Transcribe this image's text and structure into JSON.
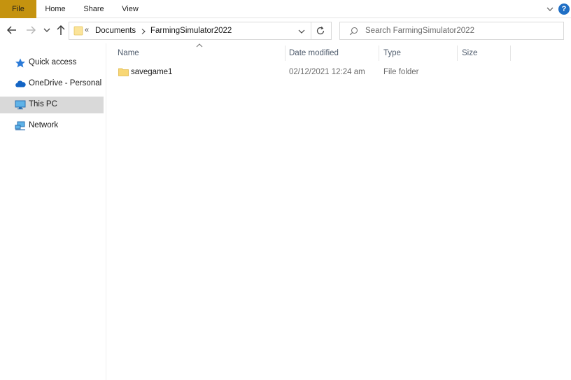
{
  "ribbon": {
    "tabs": [
      {
        "label": "File"
      },
      {
        "label": "Home"
      },
      {
        "label": "Share"
      },
      {
        "label": "View"
      }
    ],
    "help_label": "?",
    "accent_color": "#c5930f"
  },
  "navigation": {
    "address": {
      "overflow": "«",
      "crumbs": [
        "Documents",
        "FarmingSimulator2022"
      ]
    },
    "search": {
      "placeholder": "Search FarmingSimulator2022"
    }
  },
  "sidebar": {
    "items": [
      {
        "label": "Quick access",
        "icon": "star-icon",
        "selected": false
      },
      {
        "label": "OneDrive - Personal",
        "icon": "cloud-icon",
        "selected": false
      },
      {
        "label": "This PC",
        "icon": "monitor-icon",
        "selected": true
      },
      {
        "label": "Network",
        "icon": "network-icon",
        "selected": false
      }
    ]
  },
  "file_list": {
    "columns": [
      {
        "label": "Name"
      },
      {
        "label": "Date modified"
      },
      {
        "label": "Type"
      },
      {
        "label": "Size"
      }
    ],
    "sorted_by": "Name",
    "rows": [
      {
        "name": "savegame1",
        "date_modified": "02/12/2021 12:24 am",
        "type": "File folder",
        "size": "",
        "icon": "folder-icon"
      }
    ]
  }
}
